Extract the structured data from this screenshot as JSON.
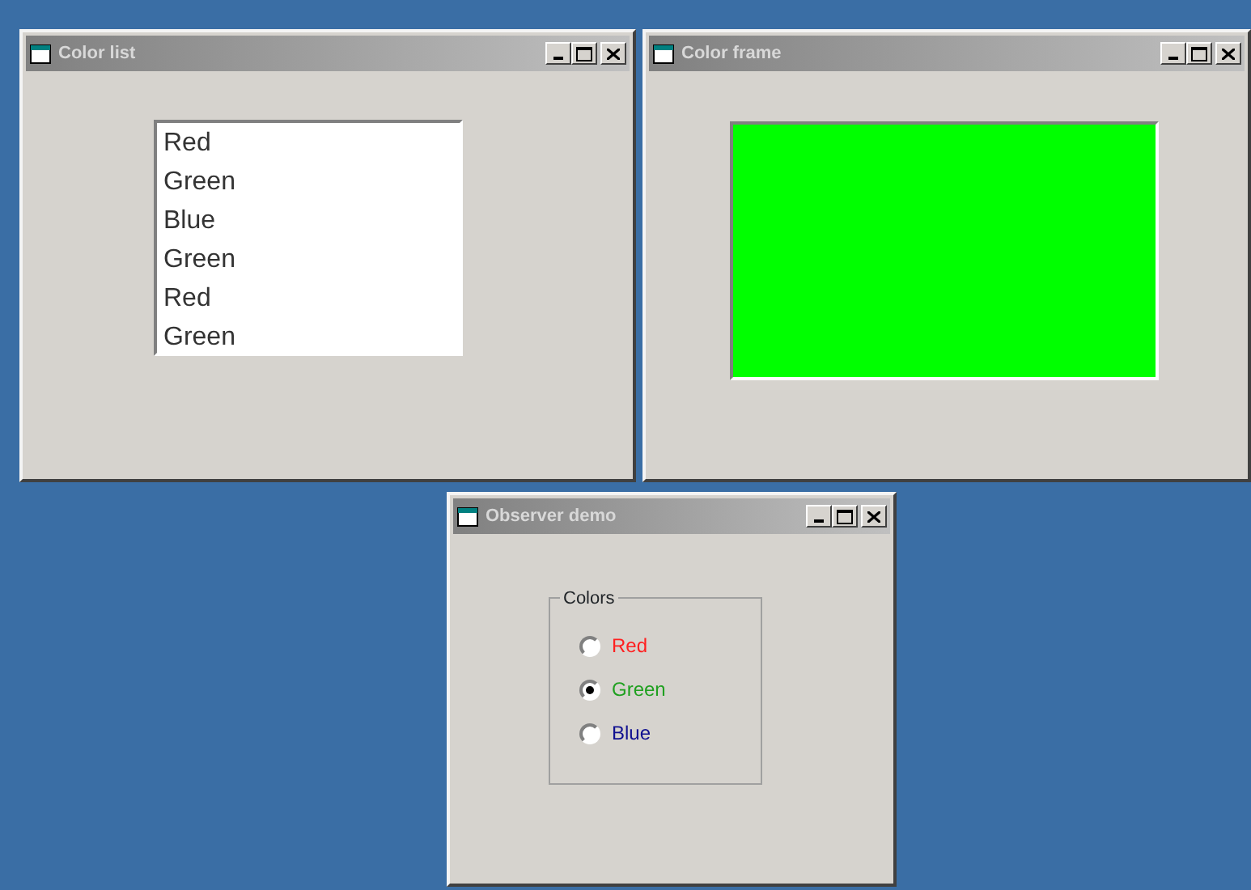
{
  "windows": [
    {
      "title": "Color list",
      "kind": "list",
      "items": [
        "Red",
        "Green",
        "Blue",
        "Green",
        "Red",
        "Green"
      ]
    },
    {
      "title": "Color frame",
      "kind": "frame",
      "color": "#00ff00"
    },
    {
      "title": "Observer demo",
      "kind": "radios",
      "group": "Colors",
      "options": [
        {
          "label": "Red",
          "color": "#ff2020",
          "selected": false
        },
        {
          "label": "Green",
          "color": "#20a020",
          "selected": true
        },
        {
          "label": "Blue",
          "color": "#101090",
          "selected": false
        }
      ]
    }
  ]
}
